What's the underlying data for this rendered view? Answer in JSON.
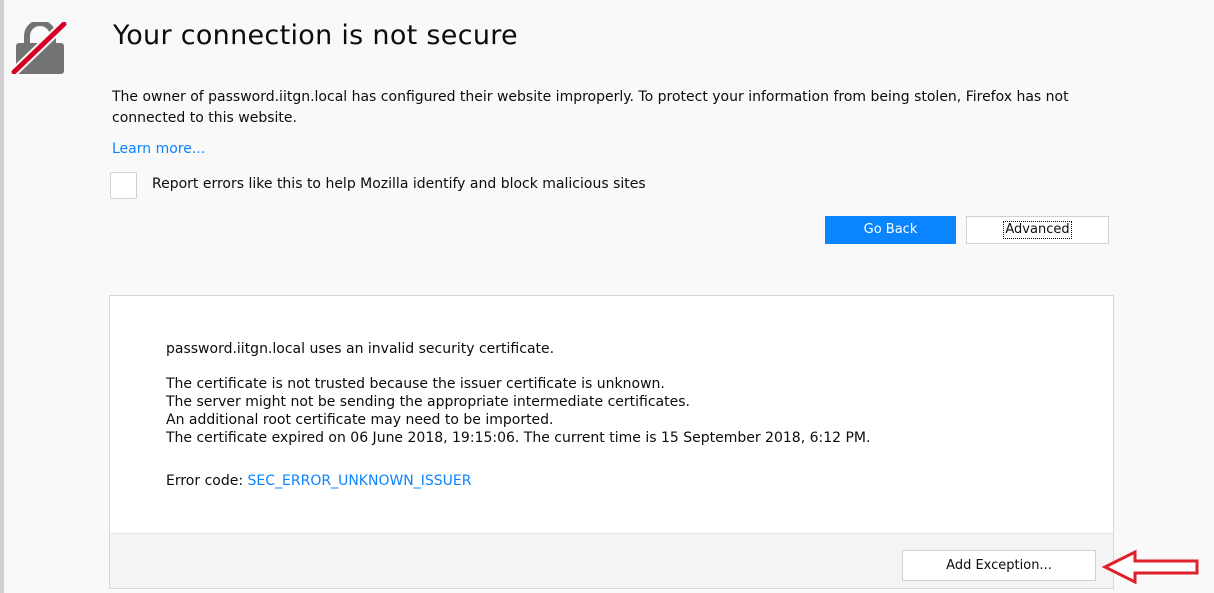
{
  "error_page": {
    "title": "Your connection is not secure",
    "description": "The owner of password.iitgn.local has configured their website improperly. To protect your information from being stolen, Firefox has not connected to this website.",
    "learn_more": "Learn more...",
    "report_label": "Report errors like this to help Mozilla identify and block malicious sites",
    "report_checked": false,
    "go_back_label": "Go Back",
    "advanced_label": "Advanced"
  },
  "advanced": {
    "invalid_cert": "password.iitgn.local uses an invalid security certificate.",
    "reasons": [
      "The certificate is not trusted because the issuer certificate is unknown.",
      "The server might not be sending the appropriate intermediate certificates.",
      "An additional root certificate may need to be imported.",
      "The certificate expired on 06 June 2018, 19:15:06. The current time is 15 September 2018, 6:12 PM."
    ],
    "error_code_label": "Error code: ",
    "error_code": "SEC_ERROR_UNKNOWN_ISSUER",
    "add_exception_label": "Add Exception..."
  },
  "icons": {
    "lock": "broken-lock-icon",
    "annotation": "red-arrow-annotation"
  },
  "colors": {
    "background": "#f9f9fa",
    "accent_blue": "#0a84ff",
    "lock_grey": "#737373",
    "strike_red": "#d70022",
    "annotation_red": "#e0202a"
  }
}
